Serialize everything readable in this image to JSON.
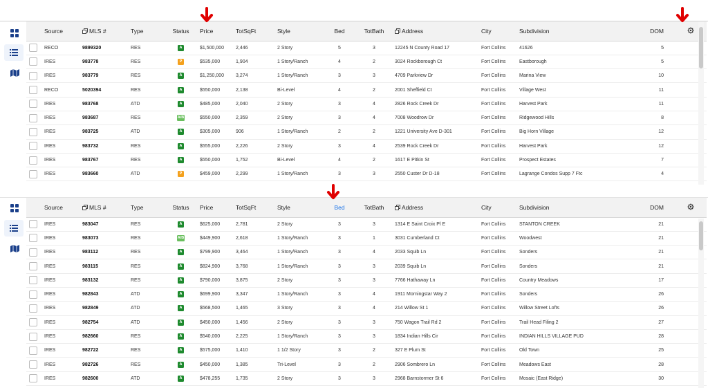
{
  "colors": {
    "accent": "#1a3f8a",
    "active_badge": "#1e8a2e",
    "pending_badge": "#f4a11d",
    "ab_badge": "#6abf5e",
    "arrow": "#e00000",
    "highlight_header": "#1a73e8"
  },
  "sidebar": {
    "grid_icon": "grid-icon",
    "list_icon": "list-icon",
    "map_icon": "map-icon"
  },
  "columns": [
    "",
    "Source",
    "MLS #",
    "Type",
    "Status",
    "Price",
    "TotSqFt",
    "Style",
    "Bed",
    "TotBath",
    "Address",
    "City",
    "Subdivision",
    "DOM",
    ""
  ],
  "panel1": {
    "rows": [
      {
        "source": "RECO",
        "mls": "9899320",
        "type": "RES",
        "status": "A",
        "price": "$1,500,000",
        "sqft": "2,446",
        "style": "2 Story",
        "bed": "5",
        "bath": "3",
        "address": "12245 N County Road 17",
        "city": "Fort Collins",
        "subdivision": "41626",
        "dom": "5"
      },
      {
        "source": "IRES",
        "mls": "983778",
        "type": "RES",
        "status": "P",
        "price": "$535,000",
        "sqft": "1,904",
        "style": "1 Story/Ranch",
        "bed": "4",
        "bath": "2",
        "address": "3024 Rockborough Ct",
        "city": "Fort Collins",
        "subdivision": "Eastborough",
        "dom": "5"
      },
      {
        "source": "IRES",
        "mls": "983779",
        "type": "RES",
        "status": "A",
        "price": "$1,250,000",
        "sqft": "3,274",
        "style": "1 Story/Ranch",
        "bed": "3",
        "bath": "3",
        "address": "4709 Parkview Dr",
        "city": "Fort Collins",
        "subdivision": "Marina View",
        "dom": "10"
      },
      {
        "source": "RECO",
        "mls": "5020394",
        "type": "RES",
        "status": "A",
        "price": "$550,000",
        "sqft": "2,138",
        "style": "Bi-Level",
        "bed": "4",
        "bath": "2",
        "address": "2001 Sheffield Ct",
        "city": "Fort Collins",
        "subdivision": "Village West",
        "dom": "11"
      },
      {
        "source": "IRES",
        "mls": "983768",
        "type": "ATD",
        "status": "A",
        "price": "$485,000",
        "sqft": "2,040",
        "style": "2 Story",
        "bed": "3",
        "bath": "4",
        "address": "2826 Rock Creek Dr",
        "city": "Fort Collins",
        "subdivision": "Harvest Park",
        "dom": "11"
      },
      {
        "source": "IRES",
        "mls": "983687",
        "type": "RES",
        "status": "A/B",
        "price": "$550,000",
        "sqft": "2,359",
        "style": "2 Story",
        "bed": "3",
        "bath": "4",
        "address": "7008 Woodrow Dr",
        "city": "Fort Collins",
        "subdivision": "Ridgewood Hills",
        "dom": "8"
      },
      {
        "source": "IRES",
        "mls": "983725",
        "type": "ATD",
        "status": "A",
        "price": "$305,000",
        "sqft": "906",
        "style": "1 Story/Ranch",
        "bed": "2",
        "bath": "2",
        "address": "1221 University Ave D-301",
        "city": "Fort Collins",
        "subdivision": "Big Horn Village",
        "dom": "12"
      },
      {
        "source": "IRES",
        "mls": "983732",
        "type": "RES",
        "status": "A",
        "price": "$555,000",
        "sqft": "2,226",
        "style": "2 Story",
        "bed": "3",
        "bath": "4",
        "address": "2539 Rock Creek Dr",
        "city": "Fort Collins",
        "subdivision": "Harvest Park",
        "dom": "12"
      },
      {
        "source": "IRES",
        "mls": "983767",
        "type": "RES",
        "status": "A",
        "price": "$550,000",
        "sqft": "1,752",
        "style": "Bi-Level",
        "bed": "4",
        "bath": "2",
        "address": "1617 E Pitkin St",
        "city": "Fort Collins",
        "subdivision": "Prospect Estates",
        "dom": "7"
      },
      {
        "source": "IRES",
        "mls": "983660",
        "type": "ATD",
        "status": "P",
        "price": "$459,000",
        "sqft": "2,299",
        "style": "1 Story/Ranch",
        "bed": "3",
        "bath": "3",
        "address": "2550 Custer Dr D-18",
        "city": "Fort Collins",
        "subdivision": "Lagrange Condos Supp 7 Ftc",
        "dom": "4"
      }
    ]
  },
  "panel2": {
    "rows": [
      {
        "source": "IRES",
        "mls": "983047",
        "type": "RES",
        "status": "A",
        "price": "$625,000",
        "sqft": "2,781",
        "style": "2 Story",
        "bed": "3",
        "bath": "3",
        "address": "1314 E Saint Croix Pl E",
        "city": "Fort Collins",
        "subdivision": "STANTON CREEK",
        "dom": "21"
      },
      {
        "source": "IRES",
        "mls": "983073",
        "type": "RES",
        "status": "A/B",
        "price": "$449,900",
        "sqft": "2,618",
        "style": "1 Story/Ranch",
        "bed": "3",
        "bath": "1",
        "address": "3031 Cumberland Ct",
        "city": "Fort Collins",
        "subdivision": "Woodwest",
        "dom": "21"
      },
      {
        "source": "IRES",
        "mls": "983112",
        "type": "RES",
        "status": "A",
        "price": "$799,900",
        "sqft": "3,464",
        "style": "1 Story/Ranch",
        "bed": "3",
        "bath": "4",
        "address": "2033 Squib Ln",
        "city": "Fort Collins",
        "subdivision": "Sonders",
        "dom": "21"
      },
      {
        "source": "IRES",
        "mls": "983115",
        "type": "RES",
        "status": "A",
        "price": "$824,900",
        "sqft": "3,768",
        "style": "1 Story/Ranch",
        "bed": "3",
        "bath": "3",
        "address": "2039 Squib Ln",
        "city": "Fort Collins",
        "subdivision": "Sonders",
        "dom": "21"
      },
      {
        "source": "IRES",
        "mls": "983132",
        "type": "RES",
        "status": "A",
        "price": "$790,000",
        "sqft": "3,875",
        "style": "2 Story",
        "bed": "3",
        "bath": "3",
        "address": "7766 Hathaway Ln",
        "city": "Fort Collins",
        "subdivision": "Country Meadows",
        "dom": "17"
      },
      {
        "source": "IRES",
        "mls": "982843",
        "type": "ATD",
        "status": "A",
        "price": "$699,900",
        "sqft": "3,347",
        "style": "1 Story/Ranch",
        "bed": "3",
        "bath": "4",
        "address": "1911 Morningstar Way 2",
        "city": "Fort Collins",
        "subdivision": "Sonders",
        "dom": "26"
      },
      {
        "source": "IRES",
        "mls": "982849",
        "type": "ATD",
        "status": "A",
        "price": "$568,500",
        "sqft": "1,465",
        "style": "3 Story",
        "bed": "3",
        "bath": "4",
        "address": "214 Willow St 1",
        "city": "Fort Collins",
        "subdivision": "Willow Street Lofts",
        "dom": "26"
      },
      {
        "source": "IRES",
        "mls": "982754",
        "type": "ATD",
        "status": "A",
        "price": "$450,000",
        "sqft": "1,456",
        "style": "2 Story",
        "bed": "3",
        "bath": "3",
        "address": "750 Wagon Trail Rd 2",
        "city": "Fort Collins",
        "subdivision": "Trail Head Filing 2",
        "dom": "27"
      },
      {
        "source": "IRES",
        "mls": "982660",
        "type": "RES",
        "status": "A",
        "price": "$540,000",
        "sqft": "2,225",
        "style": "1 Story/Ranch",
        "bed": "3",
        "bath": "3",
        "address": "1834 Indian Hills Cir",
        "city": "Fort Collins",
        "subdivision": "INDIAN HILLS VILLAGE PUD",
        "dom": "28"
      },
      {
        "source": "IRES",
        "mls": "982722",
        "type": "RES",
        "status": "A",
        "price": "$575,000",
        "sqft": "1,410",
        "style": "1 1/2 Story",
        "bed": "3",
        "bath": "2",
        "address": "327 E Plum St",
        "city": "Fort Collins",
        "subdivision": "Old Town",
        "dom": "25"
      },
      {
        "source": "IRES",
        "mls": "982726",
        "type": "RES",
        "status": "A",
        "price": "$450,000",
        "sqft": "1,385",
        "style": "Tri-Level",
        "bed": "3",
        "bath": "2",
        "address": "2906 Sombrero Ln",
        "city": "Fort Collins",
        "subdivision": "Meadows East",
        "dom": "28"
      },
      {
        "source": "IRES",
        "mls": "982600",
        "type": "ATD",
        "status": "A",
        "price": "$478,255",
        "sqft": "1,735",
        "style": "2 Story",
        "bed": "3",
        "bath": "3",
        "address": "2968 Barnstormer St 6",
        "city": "Fort Collins",
        "subdivision": "Mosaic (East Ridge)",
        "dom": "30"
      }
    ]
  }
}
